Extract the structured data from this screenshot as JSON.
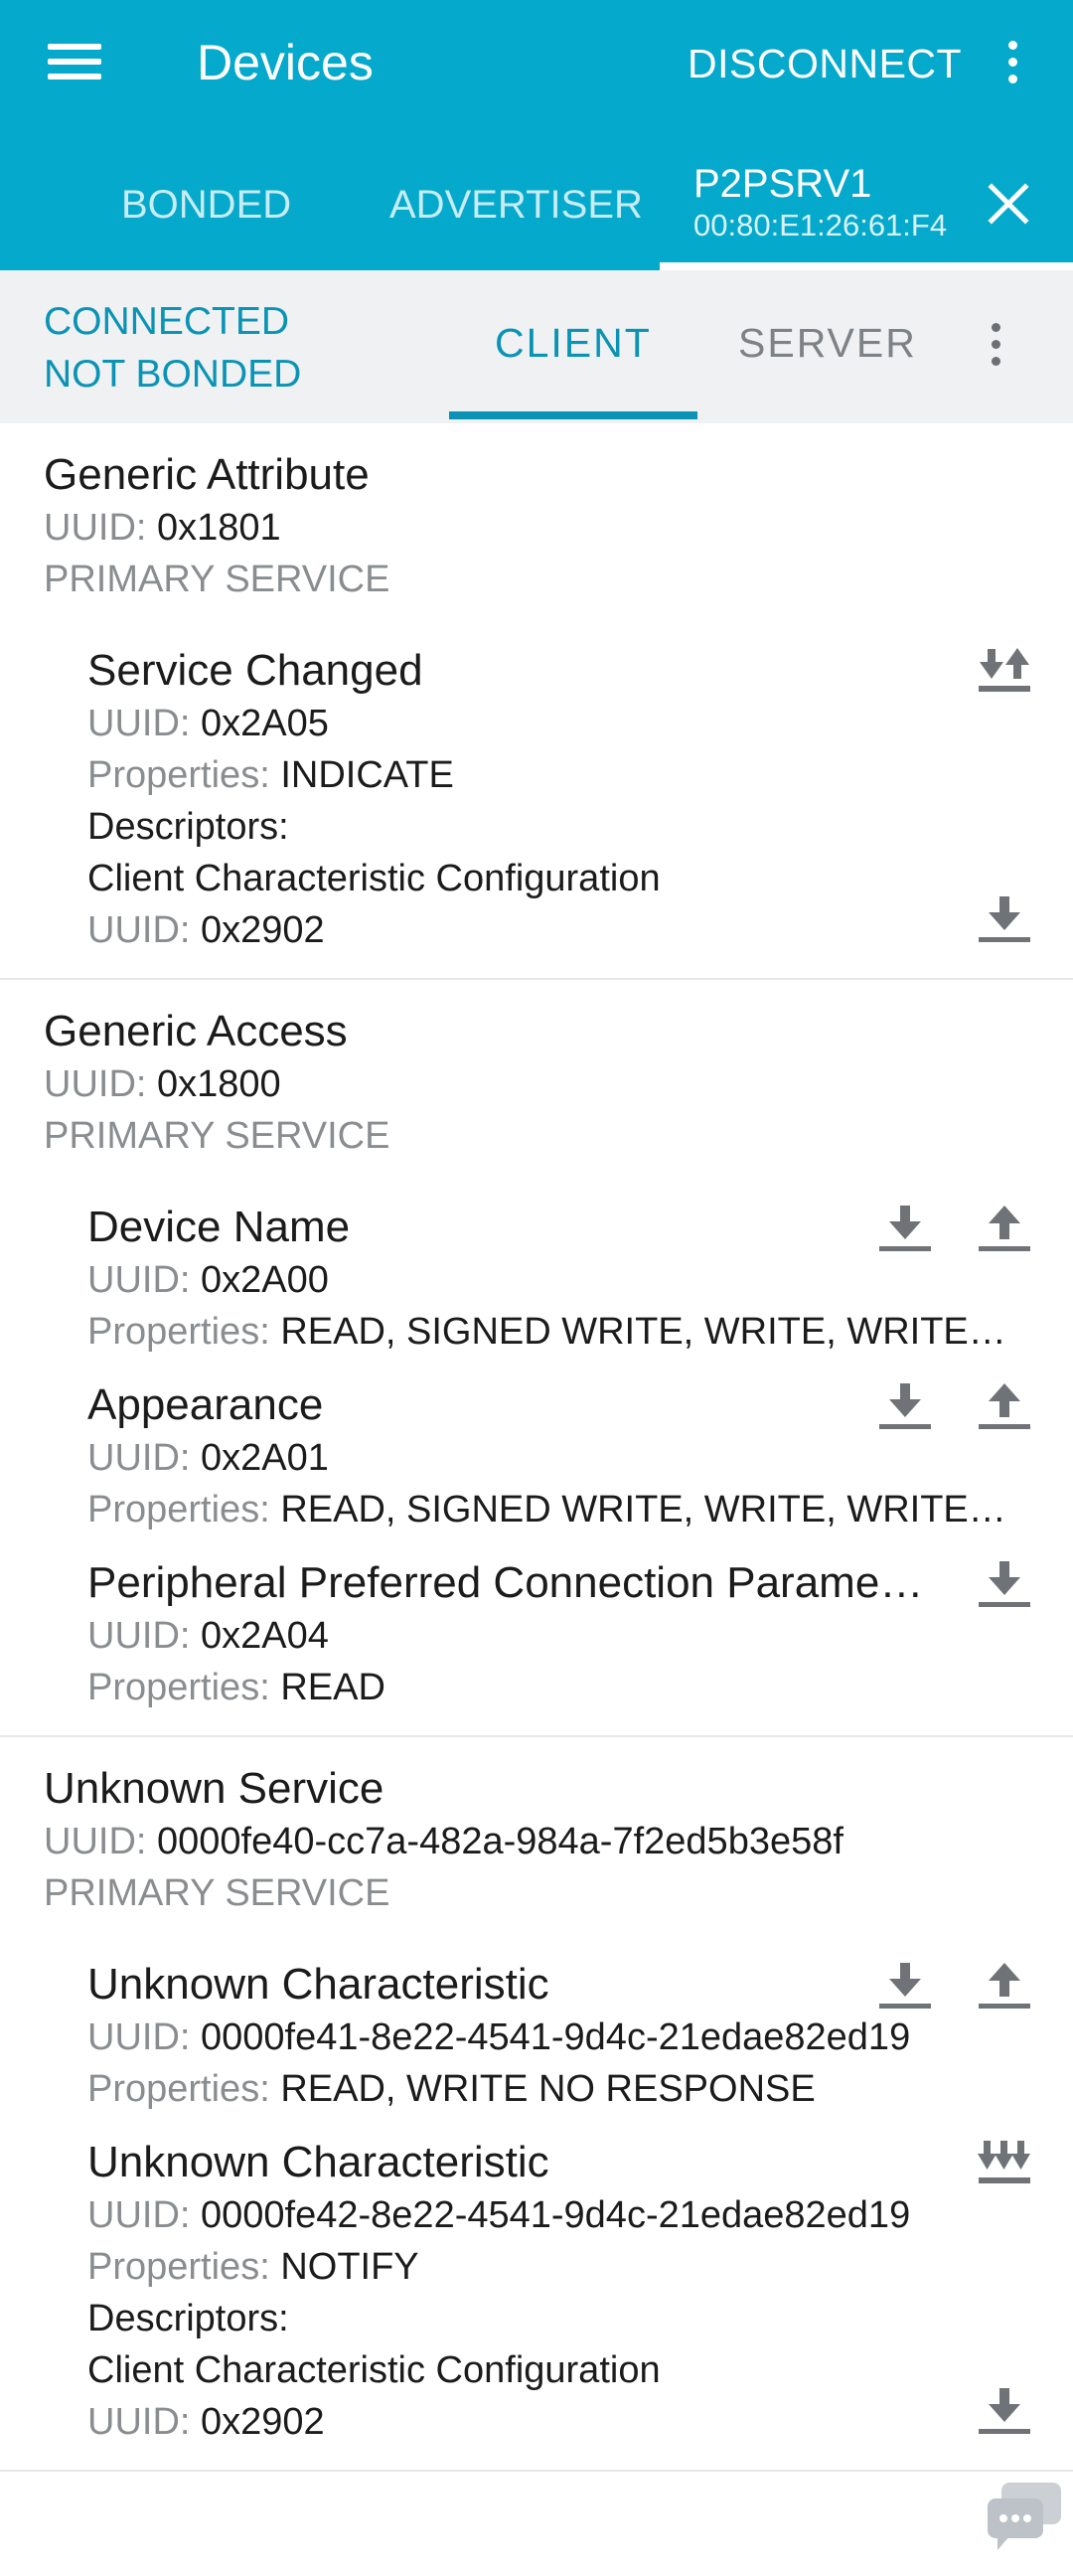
{
  "app_bar": {
    "title": "Devices",
    "disconnect_label": "DISCONNECT",
    "menu_icon": "hamburger-menu-icon",
    "overflow_icon": "more-vertical-icon"
  },
  "device_tabs": {
    "bonded": "BONDED",
    "advertiser": "ADVERTISER",
    "device_name": "P2PSRV1",
    "device_address": "00:80:E1:26:61:F4",
    "close_icon": "close-icon"
  },
  "connection": {
    "state": "CONNECTED",
    "bond_state": "NOT BONDED",
    "tabs": {
      "client": "CLIENT",
      "server": "SERVER"
    }
  },
  "labels": {
    "uuid": "UUID:",
    "properties": "Properties:",
    "descriptors": "Descriptors:"
  },
  "services": [
    {
      "name": "Generic Attribute",
      "uuid": "0x1801",
      "type": "PRIMARY SERVICE",
      "characteristics": [
        {
          "name": "Service Changed",
          "uuid": "0x2A05",
          "properties": "INDICATE",
          "descriptor_name": "Client Characteristic Configuration",
          "descriptor_uuid": "0x2902"
        }
      ]
    },
    {
      "name": "Generic Access",
      "uuid": "0x1800",
      "type": "PRIMARY SERVICE",
      "characteristics": [
        {
          "name": "Device Name",
          "uuid": "0x2A00",
          "properties": "READ, SIGNED WRITE, WRITE, WRITE NO RESPONSE"
        },
        {
          "name": "Appearance",
          "uuid": "0x2A01",
          "properties": "READ, SIGNED WRITE, WRITE, WRITE NO RESPONSE"
        },
        {
          "name": "Peripheral Preferred Connection Parameters",
          "uuid": "0x2A04",
          "properties": "READ"
        }
      ]
    },
    {
      "name": "Unknown Service",
      "uuid": "0000fe40-cc7a-482a-984a-7f2ed5b3e58f",
      "type": "PRIMARY SERVICE",
      "characteristics": [
        {
          "name": "Unknown Characteristic",
          "uuid": "0000fe41-8e22-4541-9d4c-21edae82ed19",
          "properties": "READ, WRITE NO RESPONSE"
        },
        {
          "name": "Unknown Characteristic",
          "uuid": "0000fe42-8e22-4541-9d4c-21edae82ed19",
          "properties": "NOTIFY",
          "descriptor_name": "Client Characteristic Configuration",
          "descriptor_uuid": "0x2902"
        }
      ]
    }
  ],
  "colors": {
    "app_bar": "#05a9cc",
    "accent": "#0a93b5",
    "sub_bar": "#eff1f2",
    "icon_gray": "#6f7276",
    "secondary_text": "#8a8d90"
  },
  "action_icons": [
    "download-icon",
    "upload-icon",
    "indicate-icon",
    "notify-icon"
  ]
}
